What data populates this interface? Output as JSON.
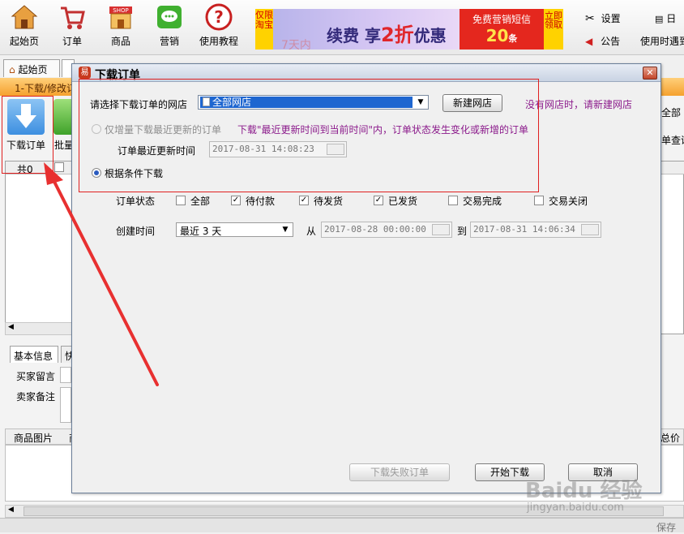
{
  "toolbar": {
    "home": "起始页",
    "orders": "订单",
    "products": "商品",
    "marketing": "营销",
    "tutorial": "使用教程",
    "settings": "设置",
    "notice": "公告",
    "date_short": "日",
    "help": "使用时遇到",
    "banner": {
      "left_tag": "仅限淘宝",
      "main": "续费 享",
      "discount": "2折",
      "suffix": "优惠",
      "ghost": "7天内",
      "sms_title": "免费营销短信",
      "sms_count": "20",
      "sms_unit": "条",
      "claim": "立即领取"
    }
  },
  "tabs": {
    "home": "起始页"
  },
  "back": {
    "orange_bar": "1-下载/修改订",
    "download_order": "下载订单",
    "batch": "批量",
    "total": "共0",
    "right_all": "全部",
    "right_query": "单查询",
    "lower_tab_basic": "基本信息",
    "lower_tab_cut": "快",
    "buyer_msg": "买家留言",
    "seller_note": "卖家备注",
    "product_image": "商品图片",
    "product_cut": "商",
    "total_price": "总价",
    "save": "保存"
  },
  "dialog": {
    "title": "下载订单",
    "select_shop_label": "请选择下载订单的网店",
    "shop_value": "全部网店",
    "new_shop_button": "新建网店",
    "no_shop_hint": "没有网店时，请新建网店",
    "incremental_label": "仅增量下载最近更新的订单",
    "incremental_hint": "下载\"最近更新时间到当前时间\"内，订单状态发生变化或新增的订单",
    "last_update_label": "订单最近更新时间",
    "last_update_value": "2017-08-31 14:08:23",
    "by_condition_label": "根据条件下载",
    "order_status_label": "订单状态",
    "status_options": [
      {
        "label": "全部",
        "checked": false
      },
      {
        "label": "待付款",
        "checked": true
      },
      {
        "label": "待发货",
        "checked": true
      },
      {
        "label": "已发货",
        "checked": true
      },
      {
        "label": "交易完成",
        "checked": false
      },
      {
        "label": "交易关闭",
        "checked": false
      }
    ],
    "create_time_label": "创建时间",
    "create_range": "最近 3 天",
    "from_label": "从",
    "from_value": "2017-08-28 00:00:00",
    "to_label": "到",
    "to_value": "2017-08-31 14:06:34",
    "failed_button": "下载失败订单",
    "start_button": "开始下载",
    "cancel_button": "取消"
  },
  "watermark": {
    "brand": "Baidu 经验",
    "url": "jingyan.baidu.com"
  },
  "colors": {
    "accent_red": "#e02020",
    "hint_purple": "#8b1a8b",
    "select_blue": "#1e66d0"
  }
}
